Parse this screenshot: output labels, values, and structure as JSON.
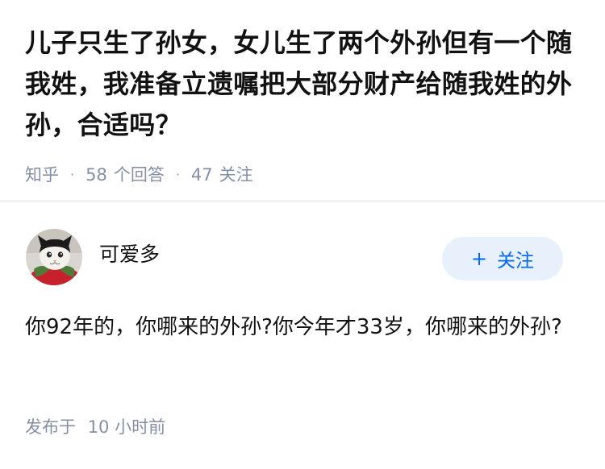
{
  "question": {
    "title": "儿子只生了孙女，女儿生了两个外孙但有一个随我姓，我准备立遗嘱把大部分财产给随我姓的外孙，合适吗？",
    "source": "知乎",
    "separator": "·",
    "answers_count": "58",
    "answers_label": "个回答",
    "followers_count": "47",
    "followers_label": "关注"
  },
  "answer": {
    "author_name": "可爱多",
    "follow_plus": "+",
    "follow_label": "关注",
    "content": "你92年的，你哪来的外孙?你今年才33岁，你哪来的外孙?",
    "published_label": "发布于",
    "published_time": "10 小时前"
  },
  "colors": {
    "accent": "#0066ff",
    "follow_bg": "#e8f1fb",
    "meta_text": "#8590a6",
    "title_text": "#121212",
    "divider": "#f0f2f5"
  },
  "icons": {
    "avatar": "cat-avatar-image"
  }
}
